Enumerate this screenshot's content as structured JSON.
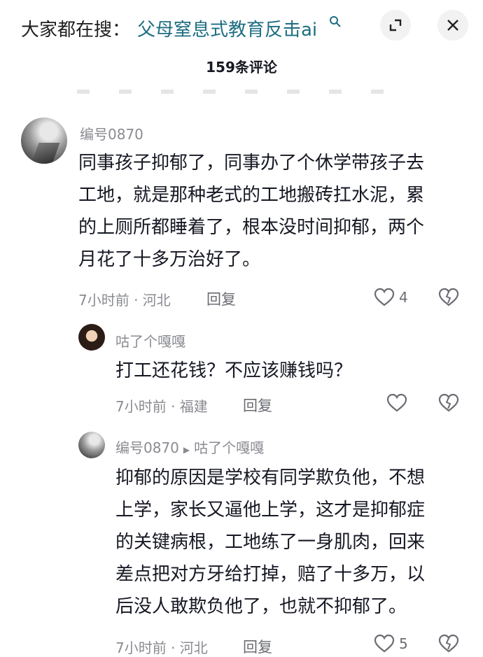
{
  "header": {
    "search_prefix": "大家都在搜：",
    "search_query": "父母窒息式教育反击ai",
    "comment_count": "159条评论"
  },
  "icons": {
    "search": "search-icon",
    "expand": "expand-icon",
    "close": "close-icon",
    "like": "heart-outline-icon",
    "dislike": "broken-heart-icon"
  },
  "colors": {
    "query_text": "#1e6e82",
    "muted_text": "#8a8b91",
    "body_text": "#161823"
  },
  "comments": [
    {
      "username": "编号0870",
      "text_lines": [
        "同事孩子抑郁了，同事办了个休学带孩子去",
        "工地，就是那种老式的工地搬砖扛水泥，累",
        "的上厕所都睡着了，根本没时间抑郁，两个",
        "月花了十多万治好了。"
      ],
      "time_location": "7小时前 · 河北",
      "reply_label": "回复",
      "likes": "4"
    }
  ],
  "replies": [
    {
      "username": "咕了个嘎嘎",
      "text_lines": [
        "打工还花钱？不应该赚钱吗？"
      ],
      "time_location": "7小时前 · 福建",
      "reply_label": "回复",
      "likes": ""
    },
    {
      "username": "编号0870",
      "reply_to": "咕了个嘎嘎",
      "text_lines": [
        "抑郁的原因是学校有同学欺负他，不想",
        "上学，家长又逼他上学，这才是抑郁症",
        "的关键病根，工地练了一身肌肉，回来",
        "差点把对方牙给打掉，赔了十多万，以",
        "后没人敢欺负他了，也就不抑郁了。"
      ],
      "time_location": "7小时前 · 河北",
      "reply_label": "回复",
      "likes": "5"
    }
  ]
}
